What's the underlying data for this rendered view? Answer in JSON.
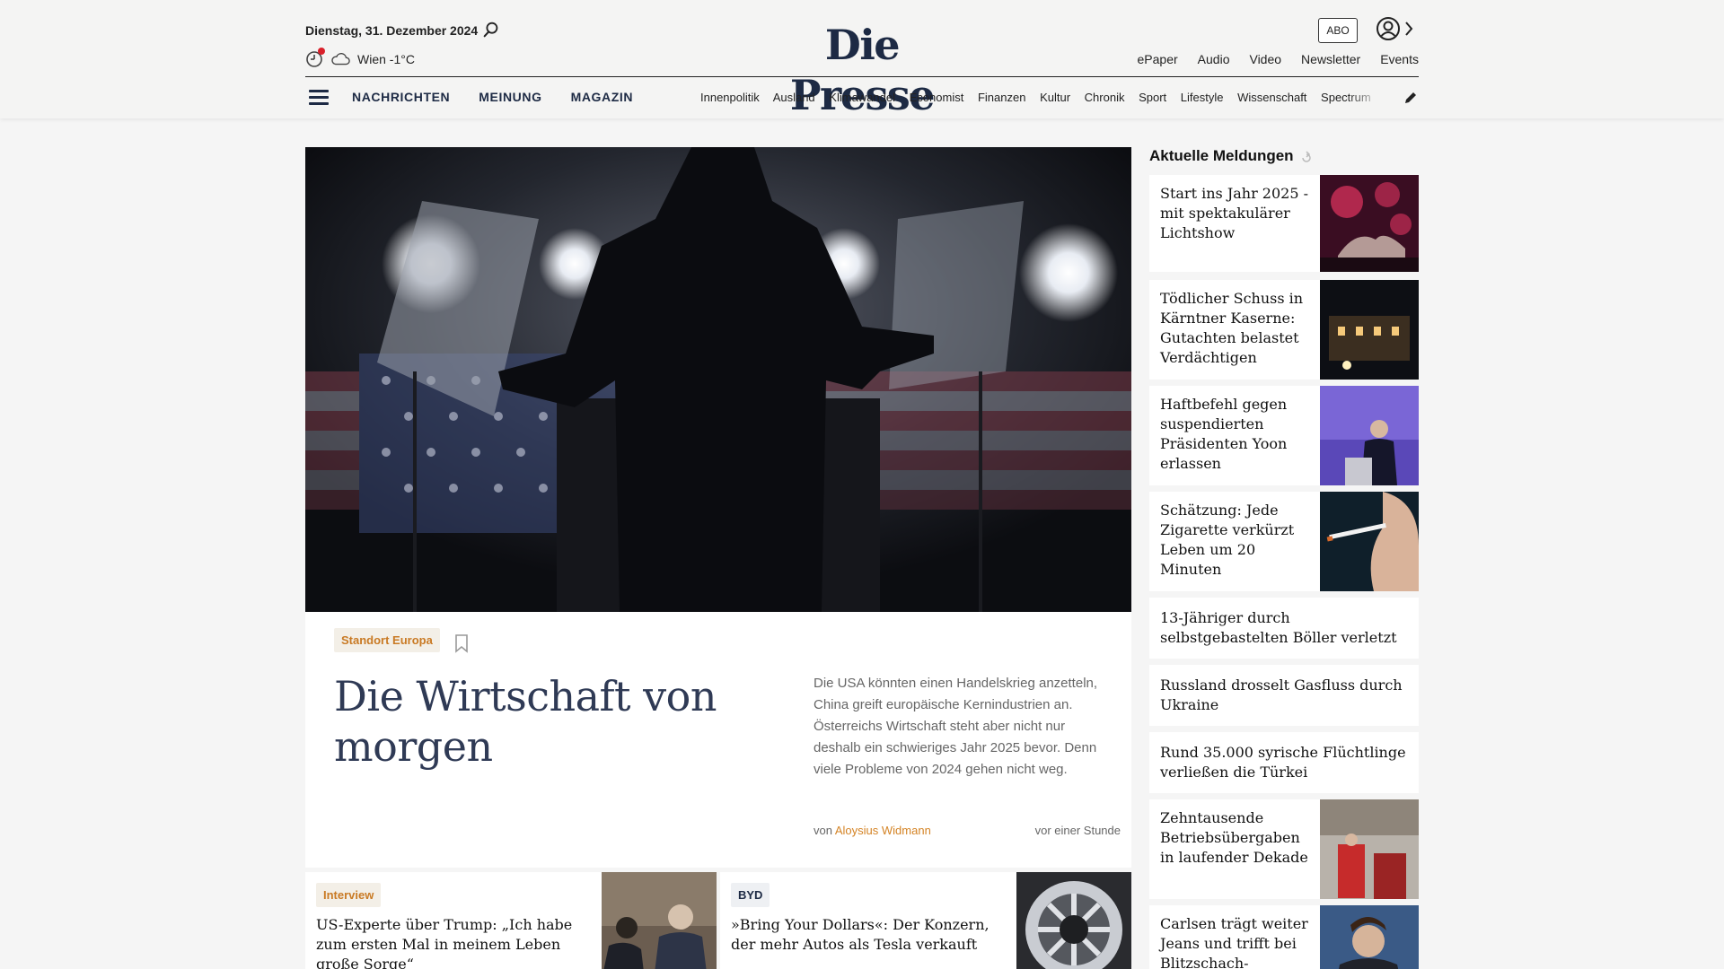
{
  "header": {
    "date": "Dienstag, 31. Dezember 2024",
    "weather": "Wien -1°C",
    "logo": "Die Presse",
    "abo_label": "ABO",
    "top_links": [
      "ePaper",
      "Audio",
      "Video",
      "Newsletter",
      "Events"
    ],
    "main_nav": [
      "NACHRICHTEN",
      "MEINUNG",
      "MAGAZIN"
    ],
    "sub_nav": [
      "Innenpolitik",
      "Ausland",
      "Klimawandel",
      "Economist",
      "Finanzen",
      "Kultur",
      "Chronik",
      "Sport",
      "Lifestyle",
      "Wissenschaft",
      "Spectrum"
    ]
  },
  "hero": {
    "tag": "Standort Europa",
    "title": "Die Wirtschaft von morgen",
    "teaser": "Die USA könnten einen Handelskrieg anzetteln, China greift europäische Kernindustrien an. Österreichs Wirtschaft steht aber nicht nur deshalb ein schwieriges Jahr 2025 bevor. Denn viele Probleme von 2024 gehen nicht weg.",
    "byline_prefix": "von",
    "author": "Aloysius Widmann",
    "time": "vor einer Stunde"
  },
  "teasers": [
    {
      "tag": "Interview",
      "title": "US-Experte über Trump: „Ich habe zum ersten Mal in meinem Leben große Sorge“"
    },
    {
      "tag": "BYD",
      "title": "»Bring Your Dollars«: Der Konzern, der mehr Autos als Tesla verkauft"
    }
  ],
  "sidebar": {
    "title": "Aktuelle Meldungen",
    "items": [
      {
        "title": "Start ins Jahr 2025 - mit spektakulärer Lichtshow"
      },
      {
        "title": "Tödlicher Schuss in Kärntner Kaserne: Gutachten belastet Verdächtigen"
      },
      {
        "title": "Haftbefehl gegen suspendierten Präsidenten Yoon erlassen"
      },
      {
        "title": "Schätzung: Jede Zigarette verkürzt Leben um 20 Minuten"
      },
      {
        "title": "13-Jähriger durch selbstgebastelten Böller verletzt"
      },
      {
        "title": "Russland drosselt Gasfluss durch Ukraine"
      },
      {
        "title": "Rund 35.000 syrische Flüchtlinge verließen die Türkei"
      },
      {
        "title": "Zehntausende Betriebsübergaben in laufender Dekade"
      },
      {
        "title": "Carlsen trägt weiter Jeans und trifft bei Blitzschach-"
      }
    ]
  },
  "colors": {
    "brand": "#1d2a44",
    "accent": "#d48324",
    "alert": "#d9202a"
  },
  "icons": [
    "search-icon",
    "clock-icon",
    "cloud-icon",
    "user-icon",
    "chevron-right-icon",
    "menu-icon",
    "edit-icon",
    "bookmark-icon",
    "refresh-icon"
  ]
}
